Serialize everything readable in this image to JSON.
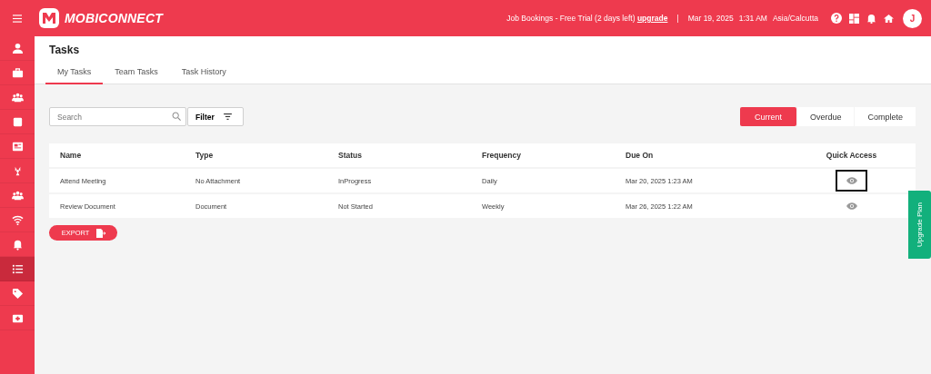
{
  "topbar": {
    "brand": "MOBICONNECT",
    "trial_notice": "Job Bookings - Free Trial (2 days left)",
    "upgrade_link": "upgrade",
    "separator": "|",
    "date": "Mar 19, 2025",
    "time": "1:31 AM",
    "timezone": "Asia/Calcutta",
    "avatar_initial": "J"
  },
  "sidebar": {
    "items": [
      {
        "selected": false
      },
      {
        "selected": false
      },
      {
        "selected": false
      },
      {
        "selected": false
      },
      {
        "selected": false
      },
      {
        "selected": false
      },
      {
        "selected": false
      },
      {
        "selected": false
      },
      {
        "selected": false
      },
      {
        "selected": true
      },
      {
        "selected": false
      },
      {
        "selected": false
      }
    ]
  },
  "page": {
    "title": "Tasks"
  },
  "tabs": [
    {
      "label": "My Tasks",
      "selected": true
    },
    {
      "label": "Team Tasks",
      "selected": false
    },
    {
      "label": "Task History",
      "selected": false
    }
  ],
  "search": {
    "placeholder": "Search"
  },
  "filter_button": "Filter",
  "status_filters": [
    {
      "label": "Current",
      "selected": true
    },
    {
      "label": "Overdue",
      "selected": false
    },
    {
      "label": "Complete",
      "selected": false
    }
  ],
  "table": {
    "columns": [
      "Name",
      "Type",
      "Status",
      "Frequency",
      "Due On",
      "Quick Access"
    ],
    "rows": [
      {
        "name": "Attend Meeting",
        "type": "No Attachment",
        "status": "InProgress",
        "frequency": "Daily",
        "due_on": "Mar 20, 2025 1:23 AM",
        "highlighted": true
      },
      {
        "name": "Review Document",
        "type": "Document",
        "status": "Not Started",
        "frequency": "Weekly",
        "due_on": "Mar 26, 2025 1:22 AM",
        "highlighted": false
      }
    ]
  },
  "export_button": "EXPORT",
  "upgrade_plan_button": "Upgrade Plan"
}
